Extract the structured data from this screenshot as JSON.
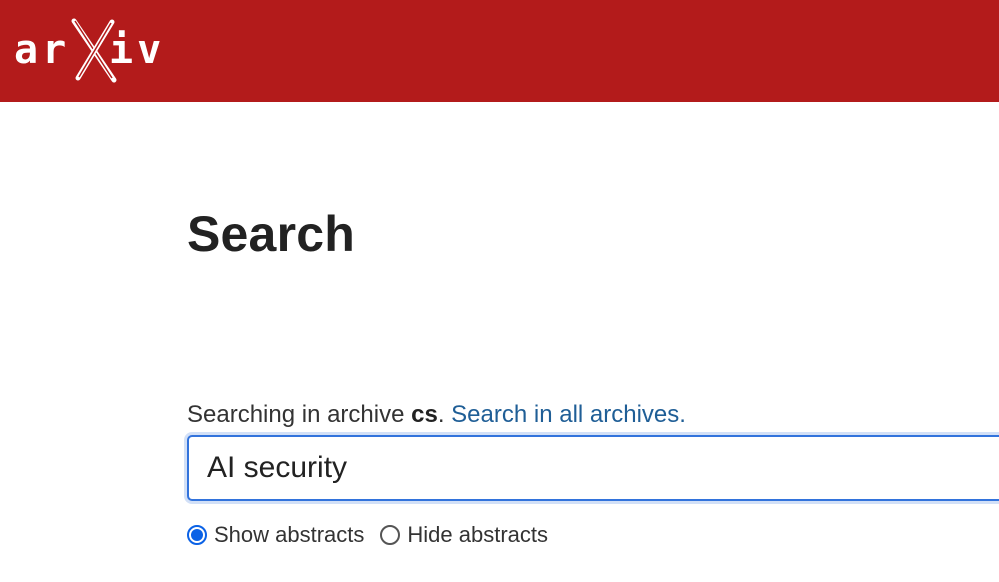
{
  "header": {
    "logo_text": "arXiv",
    "background_color": "#b31b1b"
  },
  "page": {
    "title": "Search"
  },
  "archive_notice": {
    "prefix": "Searching in archive ",
    "archive": "cs",
    "separator": ". ",
    "link_label": "Search in all archives."
  },
  "search": {
    "value": "AI security",
    "focus_color": "#3273dc"
  },
  "abstract_options": {
    "show_label": "Show abstracts",
    "hide_label": "Hide abstracts",
    "selected": "Show abstracts"
  },
  "colors": {
    "link": "#1f5e96",
    "radio_checked": "#0b62e6"
  }
}
